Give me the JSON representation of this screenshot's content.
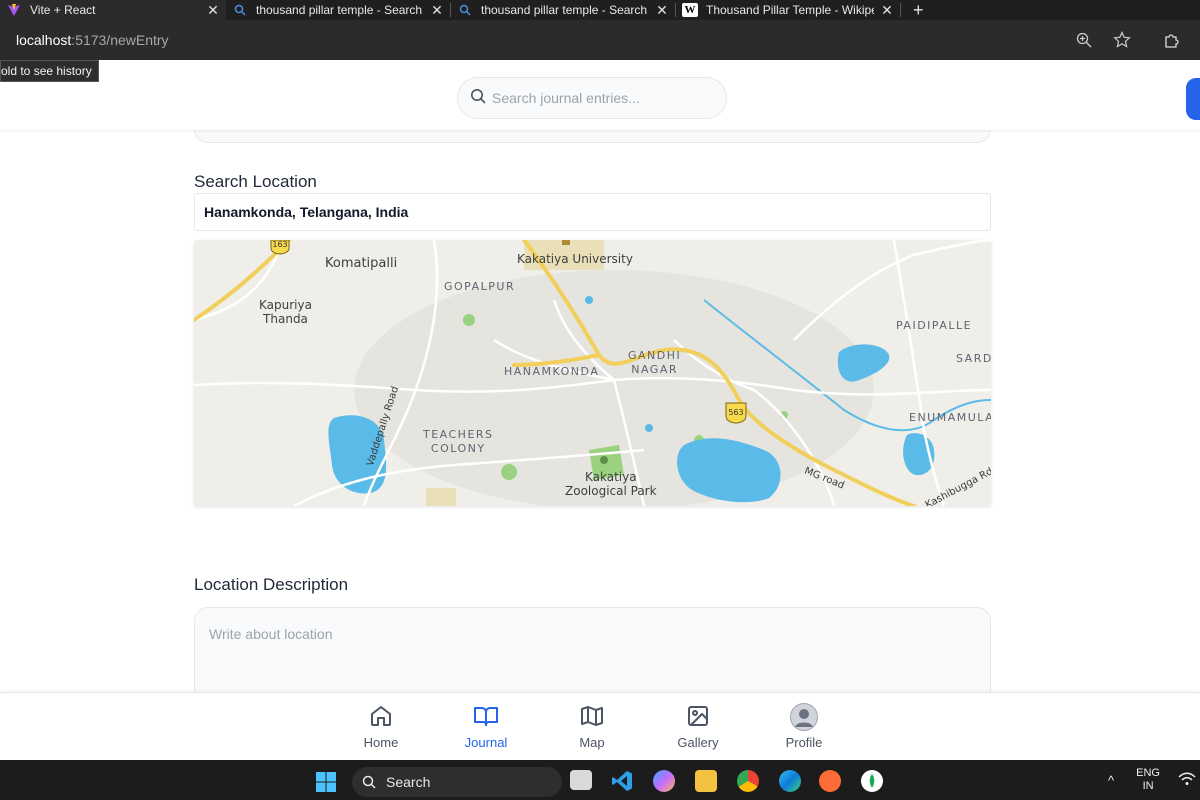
{
  "browser": {
    "tabs": [
      {
        "title": "Vite + React",
        "favicon": "vite-icon",
        "active": true
      },
      {
        "title": "thousand pillar temple - Search",
        "favicon": "search-icon",
        "active": false
      },
      {
        "title": "thousand pillar temple - Search",
        "favicon": "search-icon",
        "active": false
      },
      {
        "title": "Thousand Pillar Temple - Wikiped",
        "favicon": "wikipedia-icon",
        "active": false
      }
    ],
    "url_host": "localhost",
    "url_path": ":5173/newEntry",
    "history_tooltip": "old to see history"
  },
  "header": {
    "search_placeholder": "Search journal entries..."
  },
  "form": {
    "location_label": "Search Location",
    "location_value": "Hanamkonda, Telangana, India",
    "description_label": "Location Description",
    "description_placeholder": "Write about location"
  },
  "map": {
    "labels": {
      "komatipalli": "Komatipalli",
      "kakatiya_university": "Kakatiya University",
      "gopalpur": "GOPALPUR",
      "kapuriya_thanda": "Kapuriya\nThanda",
      "hanamkonda": "HANAMKONDA",
      "gandhi_nagar": "GANDHI\nNAGAR",
      "paidipalle": "PAIDIPALLE",
      "sard": "SARD",
      "enumamula": "ENUMAMULA",
      "teachers_colony": "TEACHERS\nCOLONY",
      "zoo": "Kakatiya\nZoological Park",
      "vaddepally_road": "Vaddepally Road",
      "mg_road": "MG road",
      "kashibugga_rd": "Kashibugga Rd",
      "shield_163": "163",
      "shield_563": "563"
    },
    "colors": {
      "water": "#5bbbe8",
      "park": "#9bd27f",
      "highway": "#f2cf5b",
      "road": "#ffffff",
      "land": "#efeee9"
    }
  },
  "nav": {
    "items": [
      {
        "label": "Home",
        "icon": "home-icon",
        "active": false
      },
      {
        "label": "Journal",
        "icon": "book-open-icon",
        "active": true
      },
      {
        "label": "Map",
        "icon": "map-icon",
        "active": false
      },
      {
        "label": "Gallery",
        "icon": "image-icon",
        "active": false
      },
      {
        "label": "Profile",
        "icon": "avatar",
        "active": false
      }
    ]
  },
  "taskbar": {
    "search_label": "Search",
    "lang_line1": "ENG",
    "lang_line2": "IN"
  },
  "colors": {
    "accent": "#2563eb",
    "text": "#1f2937",
    "muted": "#9ca3af"
  }
}
